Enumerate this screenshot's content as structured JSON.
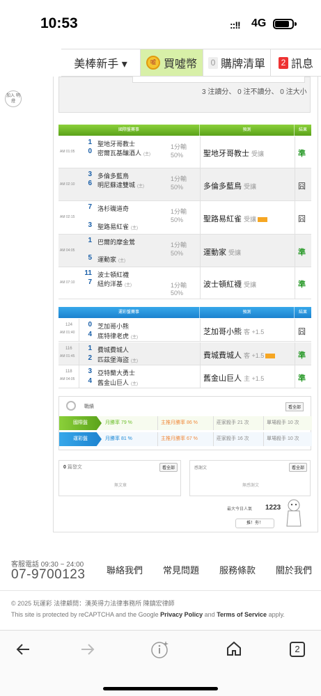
{
  "status": {
    "time": "10:53",
    "network": "4G",
    "signal": "::!!"
  },
  "nav": {
    "user": "美棒新手 ▾",
    "coin_badge": "嘘",
    "coin": "買噓幣",
    "list_count": "0",
    "list": "購牌清單",
    "msg_count": "2",
    "msg": "訊息"
  },
  "side": {
    "add_friend": "加入 明燈"
  },
  "stats": {
    "line": "3 注讀分、 0 注不讀分、 0 注大小"
  },
  "intl": {
    "headers": [
      "國際盤賽事",
      "預測",
      "結果"
    ],
    "rows": [
      {
        "time": "AM 01:05",
        "s1": "1",
        "t1": "聖地牙哥教士",
        "s2": "0",
        "t2": "密爾瓦基釀酒人",
        "t2tag": "(主)",
        "line1": "1分輸",
        "line2": "50%",
        "pred": "聖地牙哥教士",
        "pred_sub": "受讓",
        "hot": false,
        "result": "準"
      },
      {
        "time": "AM 02:10",
        "s1": "3",
        "t1": "多倫多藍鳥",
        "s2": "6",
        "t2": "明尼蘇達雙城",
        "t2tag": "(主)",
        "line1": "1分輸",
        "line2": "50%",
        "pred": "多倫多藍鳥",
        "pred_sub": "受讓",
        "hot": false,
        "result": "囧"
      },
      {
        "time": "AM 02:15",
        "s1": "7",
        "t1": "洛杉磯道奇",
        "s2": "3",
        "t2": "聖路易紅雀",
        "t2tag": "(主)",
        "line1": "1分輸",
        "line2": "50%",
        "pred": "聖路易紅雀",
        "pred_sub": "受讓",
        "hot": true,
        "result": "囧"
      },
      {
        "time": "AM 04:05",
        "s1": "1",
        "t1": "巴爾的摩金鶯",
        "s2": "5",
        "t2": "運動家",
        "t2tag": "(主)",
        "line1": "1分輸",
        "line2": "50%",
        "pred": "運動家",
        "pred_sub": "受讓",
        "hot": false,
        "result": "準"
      },
      {
        "time": "AM 07:10",
        "s1": "11",
        "t1": "波士頓紅襪",
        "s2": "7",
        "t2": "紐約洋基",
        "t2tag": "(主)",
        "line1": "1分輸",
        "line2": "50%",
        "pred": "波士頓紅襪",
        "pred_sub": "受讓",
        "hot": false,
        "result": "準"
      }
    ]
  },
  "sport": {
    "headers": [
      "運彩盤賽事",
      "預測",
      "結果"
    ],
    "rows": [
      {
        "num": "124",
        "time": "AM 01:40",
        "s1": "0",
        "t1": "芝加哥小熊",
        "s2": "4",
        "t2": "底特律老虎",
        "t2tag": "(主)",
        "pred": "芝加哥小熊",
        "pred_sub": "客 +1.5",
        "hot": false,
        "result": "囧"
      },
      {
        "num": "116",
        "time": "AM 01:45",
        "s1": "1",
        "t1": "費城費城人",
        "s2": "2",
        "t2": "匹茲堡海盜",
        "t2tag": "(主)",
        "pred": "費城費城人",
        "pred_sub": "客 +1.5",
        "hot": true,
        "result": "準"
      },
      {
        "num": "118",
        "time": "AM 04:05",
        "s1": "3",
        "t1": "亞特蘭大勇士",
        "s2": "4",
        "t2": "舊金山巨人",
        "t2tag": "(主)",
        "pred": "舊金山巨人",
        "pred_sub": "主 +1.5",
        "hot": false,
        "result": "準"
      }
    ]
  },
  "record": {
    "title": "戰績",
    "see_all": "看全部",
    "rows": [
      {
        "label": "國際盤",
        "win": "月勝率 79 %",
        "main": "主推月勝率 86 %",
        "streak": "莊家殺手 21 次",
        "single": "單場殺手 10 次"
      },
      {
        "label": "運彩盤",
        "win": "月勝率 81 %",
        "main": "主推月勝率 67 %",
        "streak": "莊家殺手 16 次",
        "single": "單場殺手 10 次"
      }
    ]
  },
  "posts": {
    "count": "0",
    "label": "篇發文",
    "see_all": "看全部",
    "empty": "無文章"
  },
  "thanks": {
    "label": "感謝文",
    "see_all": "看全部",
    "empty": "無感謝文"
  },
  "popularity": {
    "label": "最大今日人氣",
    "value": "1223",
    "button": "推！夯！"
  },
  "colors": {
    "green": "#6cbf2a",
    "blue": "#1f8ad6",
    "orange": "#f08a3c",
    "red": "#e33333"
  },
  "footer": {
    "hotline_label": "客服電話 09:30 ~ 24:00",
    "hotline": "07-9700123",
    "links": [
      "聯絡我們",
      "常見問題",
      "服務條款",
      "關於我們"
    ],
    "copyright": "© 2025 玩運彩 法律顧問：漢英得力法律事務所 陳鎮宏律師",
    "captcha_pre": "This site is protected by reCAPTCHA and the Google ",
    "privacy": "Privacy Policy",
    "and": " and ",
    "terms": "Terms of Service",
    "apply": " apply."
  },
  "bottom_nav": {
    "tabs_count": "2"
  }
}
